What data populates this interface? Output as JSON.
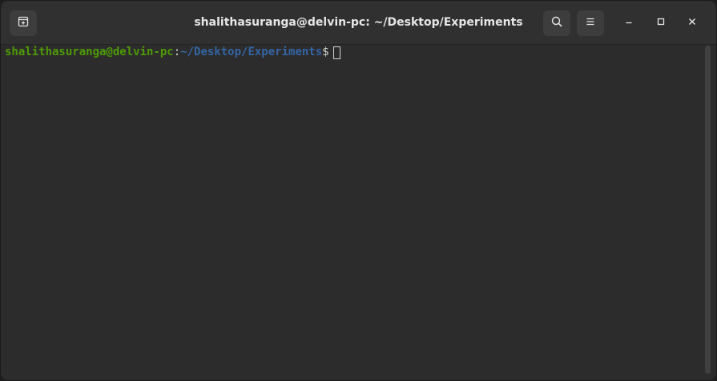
{
  "window": {
    "title": "shalithasuranga@delvin-pc: ~/Desktop/Experiments"
  },
  "toolbar": {
    "new_tab_icon": "new-tab-icon",
    "search_icon": "search-icon",
    "menu_icon": "hamburger-menu-icon"
  },
  "window_controls": {
    "minimize_icon": "minimize-icon",
    "maximize_icon": "maximize-icon",
    "close_icon": "close-icon"
  },
  "terminal": {
    "user_host": "shalithasuranga@delvin-pc",
    "colon": ":",
    "path": "~/Desktop/Experiments",
    "dollar": "$"
  },
  "colors": {
    "user_host": "#4e9a06",
    "path": "#3465a4",
    "background": "#2c2c2c",
    "text": "#d3d7cf"
  }
}
